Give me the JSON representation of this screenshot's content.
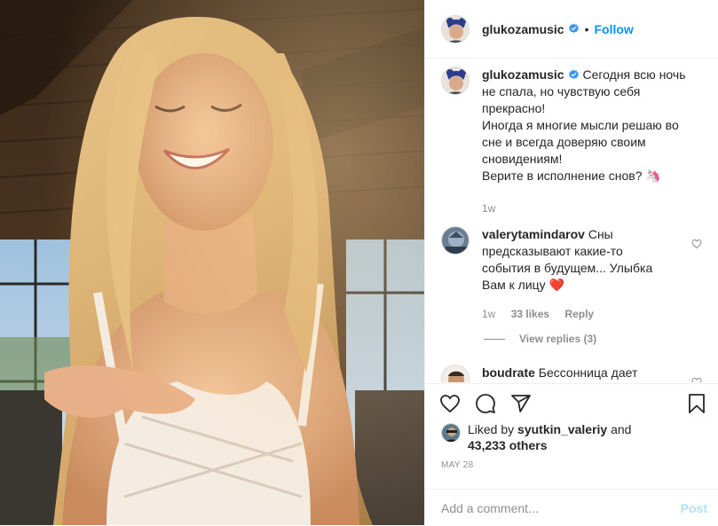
{
  "post": {
    "username": "glukozamusic",
    "follow_label": "Follow",
    "dot": "•",
    "caption_lines": [
      "Сегодня всю ночь",
      "не спала, но чувствую себя",
      "прекрасно!",
      "Иногда я многие мысли решаю во",
      "сне и всегда доверяю своим",
      "сновидениям!",
      "Верите в исполнение снов? 🦄"
    ],
    "caption_time": "1w"
  },
  "comments": [
    {
      "username": "valerytamindarov",
      "lines": [
        "Сны",
        "предсказывают какие-то",
        "события в будущем... Улыбка",
        "Вам к лицу ❤️"
      ],
      "time": "1w",
      "likes": "33 likes",
      "reply_label": "Reply",
      "view_replies": "View replies (3)"
    },
    {
      "username": "boudrate",
      "lines": [
        "Бессонница дает"
      ]
    }
  ],
  "likes": {
    "prefix": "Liked by",
    "user": "syutkin_valeriy",
    "and": "and",
    "others": "43,233 others"
  },
  "date": "MAY 28",
  "add_comment": {
    "placeholder": "Add a comment...",
    "post_label": "Post"
  },
  "colors": {
    "accent": "#0095f6",
    "text": "#262626",
    "muted": "#8e8e8e",
    "heart": "#ed4956"
  },
  "icons": [
    "heart-icon",
    "comment-icon",
    "share-icon",
    "bookmark-icon",
    "verified-icon"
  ]
}
